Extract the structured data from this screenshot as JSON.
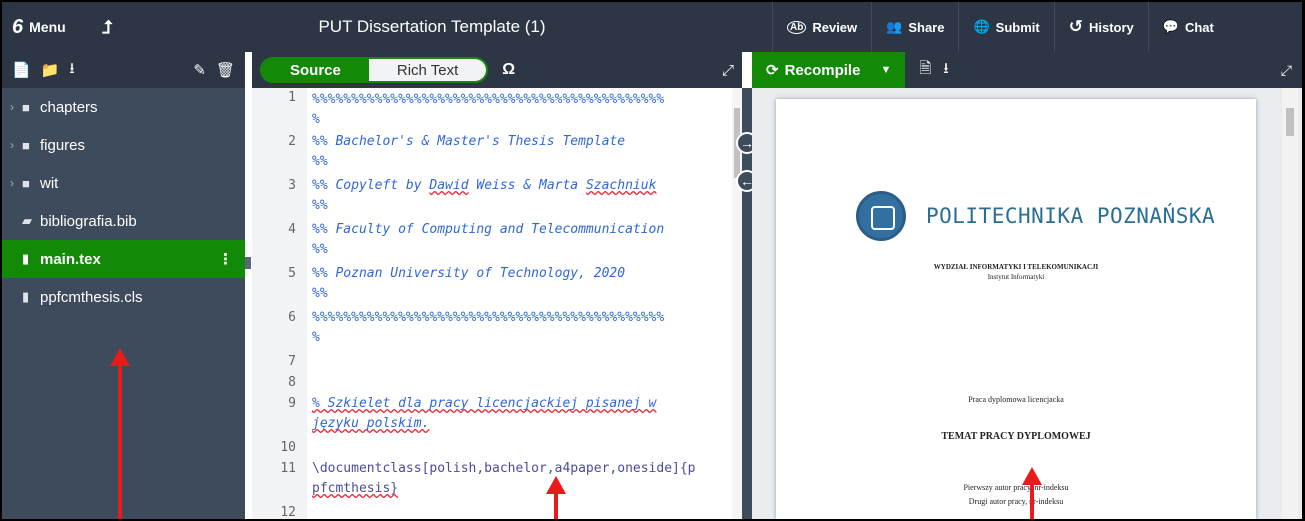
{
  "topbar": {
    "menu_label": "Menu",
    "menu_icon": "6",
    "up_icon": "⮥",
    "title": "PUT Dissertation Template (1)",
    "actions": [
      {
        "label": "Review",
        "icon": "Ab"
      },
      {
        "label": "Share",
        "icon": "👥"
      },
      {
        "label": "Submit",
        "icon": "🌐"
      },
      {
        "label": "History",
        "icon": "↺"
      },
      {
        "label": "Chat",
        "icon": "💬"
      }
    ]
  },
  "filetree": {
    "items": [
      {
        "name": "chapters",
        "type": "folder"
      },
      {
        "name": "figures",
        "type": "folder"
      },
      {
        "name": "wit",
        "type": "folder"
      },
      {
        "name": "bibliografia.bib",
        "type": "file"
      },
      {
        "name": "main.tex",
        "type": "file",
        "selected": true
      },
      {
        "name": "ppfcmthesis.cls",
        "type": "file"
      }
    ]
  },
  "editor": {
    "tabs": {
      "source": "Source",
      "rich_text": "Rich Text"
    },
    "omega": "Ω",
    "line_numbers": [
      "1",
      "2",
      "3",
      "4",
      "5",
      "6",
      "7",
      "8",
      "9",
      "10",
      "11",
      "12"
    ],
    "lines": {
      "l1a": "%%%%%%%%%%%%%%%%%%%%%%%%%%%%%%%%%%%%%%%%%%%%%",
      "l1b": "%",
      "l2a": "%% Bachelor's & Master's Thesis Template",
      "l2b": "%%",
      "l3_pre": "%% Copyleft by ",
      "l3_n1": "Dawid",
      "l3_mid": " Weiss & Marta ",
      "l3_n2": "Szachniuk",
      "l3b": "%%",
      "l4a": "%% Faculty of Computing and Telecommunication",
      "l4b": "%%",
      "l5a": "%% Poznan University of Technology, 2020",
      "l5b": "%%",
      "l6a": "%%%%%%%%%%%%%%%%%%%%%%%%%%%%%%%%%%%%%%%%%%%%%",
      "l6b": "%",
      "l9a": "% Szkielet dla pracy licencjackiej pisanej w",
      "l9b": "języku polskim.",
      "l11a": "\\documentclass[polish,bachelor,a4paper,oneside]{p",
      "l11b": "pfcmthesis}"
    }
  },
  "pdf": {
    "recompile_label": "Recompile",
    "university": "POLITECHNIKA POZNAŃSKA",
    "faculty": "WYDZIAŁ INFORMATYKI I TELEKOMUNIKACJI",
    "institute": "Instytut Informatyki",
    "work_type": "Praca dyplomowa licencjacka",
    "thesis_title": "TEMAT PRACY DYPLOMOWEJ",
    "author1": "Pierwszy autor pracy, nr-indeksu",
    "author2": "Drugi autor pracy, nr-indeksu"
  },
  "colors": {
    "accent_green": "#138a07",
    "toolbar": "#2c3645",
    "tree_bg": "#3e4b5d",
    "arrow_red": "#e81a1a",
    "university_blue": "#2a6e96"
  }
}
